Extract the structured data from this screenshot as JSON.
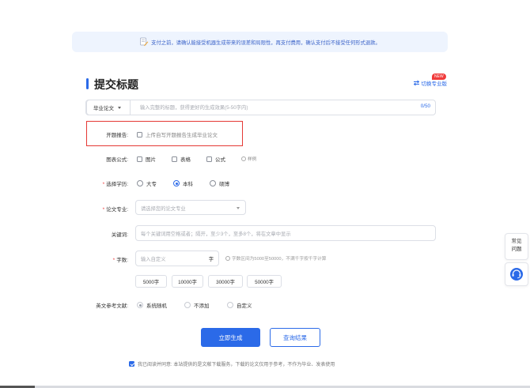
{
  "notice": {
    "text": "支付之前，请确认能接受机器生成带来的误差和局限性，再支付费用，确认支付后不接受任何形式退款。",
    "icon": "document-pen-icon"
  },
  "header": {
    "title": "提交标题",
    "switch_label": "切换专业版",
    "new_badge": "NEW",
    "accent_color": "#2b6ae8"
  },
  "topic": {
    "doc_type": "毕业论文",
    "placeholder": "输入完整的标题，获得更好的生成效果(5-50字内)",
    "count": "0/50"
  },
  "proposal": {
    "label": "开题报告:",
    "option": "上传自写开题报告生成毕业论文",
    "checked": false
  },
  "figures": {
    "label": "图表公式:",
    "options": [
      {
        "label": "图片",
        "checked": false
      },
      {
        "label": "表格",
        "checked": false
      },
      {
        "label": "公式",
        "checked": false
      }
    ],
    "example": "样例"
  },
  "degree": {
    "label": "选择学历:",
    "options": [
      {
        "label": "大专",
        "selected": false
      },
      {
        "label": "本科",
        "selected": true
      },
      {
        "label": "硕博",
        "selected": false
      }
    ]
  },
  "major": {
    "label": "论文专业:",
    "placeholder": "请选择您的论文专业"
  },
  "keywords": {
    "label": "关键词:",
    "placeholder": "每个关键词用空格或者；隔开，至少3个，至多8个，将在文章中显示"
  },
  "word_count": {
    "label": "字数:",
    "placeholder": "输入自定义",
    "unit": "字",
    "hint": "字数区间为5000至50000，不满千字按千字计算",
    "presets": [
      "5000字",
      "10000字",
      "30000字",
      "50000字"
    ]
  },
  "references": {
    "label": "英文参考文献:",
    "options": [
      {
        "label": "系统随机",
        "selected": true
      },
      {
        "label": "不添加",
        "selected": false
      },
      {
        "label": "自定义",
        "selected": false
      }
    ]
  },
  "actions": {
    "generate": "立即生成",
    "query": "查询结果"
  },
  "agreement": {
    "text": "我已阅读并同意: 本站提供的是文献下载服务，下载的论文仅用于参考，不作为毕业、发表使用",
    "checked": true
  },
  "sidebar": {
    "faq_line1": "常见",
    "faq_line2": "问题",
    "service_icon": "customer-service-headset-icon"
  }
}
